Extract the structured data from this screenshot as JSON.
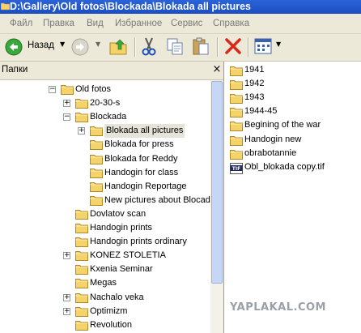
{
  "window": {
    "title": "D:\\Gallery\\Old fotos\\Blockada\\Blokada all pictures"
  },
  "menu": [
    "Файл",
    "Правка",
    "Вид",
    "Избранное",
    "Сервис",
    "Справка"
  ],
  "toolbar": {
    "back_label": "Назад"
  },
  "folders_pane": {
    "header": "Папки",
    "close": "×",
    "tree": [
      {
        "label": "Old fotos",
        "expander": "−"
      },
      {
        "label": "20-30-s",
        "expander": "+"
      },
      {
        "label": "Blockada",
        "expander": "−"
      },
      {
        "label": "Blokada all pictures",
        "expander": "+",
        "selected": true
      },
      {
        "label": "Blokada for press"
      },
      {
        "label": "Blokada for Reddy"
      },
      {
        "label": "Handogin for class"
      },
      {
        "label": "Handogin Reportage"
      },
      {
        "label": "New pictures about Blocada"
      },
      {
        "label": "Dovlatov scan"
      },
      {
        "label": "Handogin prints"
      },
      {
        "label": "Handogin prints ordinary"
      },
      {
        "label": "KONEZ STOLETIA",
        "expander": "+"
      },
      {
        "label": "Kxenia Seminar"
      },
      {
        "label": "Megas"
      },
      {
        "label": "Nachalo veka",
        "expander": "+"
      },
      {
        "label": "Optimizm",
        "expander": "+"
      },
      {
        "label": "Revolution"
      }
    ]
  },
  "contents": [
    {
      "label": "1941",
      "type": "folder"
    },
    {
      "label": "1942",
      "type": "folder"
    },
    {
      "label": "1943",
      "type": "folder"
    },
    {
      "label": "1944-45",
      "type": "folder"
    },
    {
      "label": "Begining of the war",
      "type": "folder"
    },
    {
      "label": "Handogin new",
      "type": "folder"
    },
    {
      "label": "obrabotannie",
      "type": "folder"
    },
    {
      "label": "Obl_blokada copy.tif",
      "type": "tif-file",
      "badge": "TIF"
    }
  ],
  "watermark": "YAPLAKAL.COM",
  "colors": {
    "titlebar": "#2b63d8",
    "chrome": "#ece9d8",
    "folder": "#f4d36b"
  }
}
